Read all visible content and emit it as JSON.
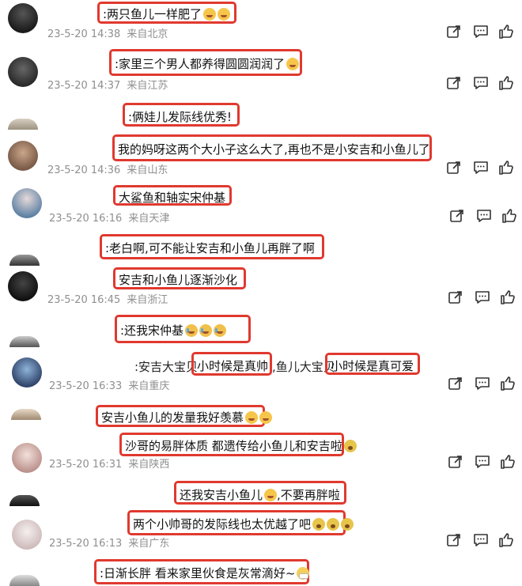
{
  "comments": [
    {
      "text": ":两只鱼儿一样肥了",
      "emojis": [
        "smile",
        "laugh"
      ],
      "time": "23-5-20 14:38",
      "location": "来自北京"
    },
    {
      "text": ":家里三个男人都养得圆圆润润了",
      "emojis": [
        "laugh"
      ],
      "time": "23-5-20 14:37",
      "location": "来自江苏"
    },
    {
      "text": ":俩娃儿发际线优秀!",
      "emojis": [],
      "time": "",
      "location": ""
    },
    {
      "text": "我的妈呀这两个大小子这么大了,再也不是小安吉和小鱼儿了",
      "emojis": [],
      "time": "23-5-20 14:36",
      "location": "来自山东"
    },
    {
      "text": "大鲨鱼和轴实宋仲基",
      "emojis": [],
      "time": "23-5-20 16:16",
      "location": "来自天津"
    },
    {
      "text": ":老白啊,可不能让安吉和小鱼儿再胖了啊",
      "emojis": [],
      "time": "",
      "location": ""
    },
    {
      "text": "安吉和小鱼儿逐渐沙化",
      "emojis": [],
      "time": "23-5-20 16:45",
      "location": "来自浙江"
    },
    {
      "text": ":还我宋仲基",
      "emojis": [
        "cry",
        "cry",
        "cry"
      ],
      "time": "",
      "location": ""
    },
    {
      "prefix": ":安吉大宝贝",
      "text_a": "小时候是真帅",
      "middle": ",鱼儿大宝贝",
      "text_b": "小时候是真可爱",
      "time": "23-5-20 16:33",
      "location": "来自重庆"
    },
    {
      "text": "安吉小鱼儿的发量我好羡慕",
      "emojis": [
        "laugh",
        "laugh"
      ],
      "time": "",
      "location": ""
    },
    {
      "text": "沙哥的易胖体质 都遗传给小鱼儿和安吉啦",
      "emojis": [
        "fear"
      ],
      "time": "23-5-20 16:31",
      "location": "来自陕西"
    },
    {
      "text": "还我安吉小鱼儿",
      "after": ",不要再胖啦",
      "emojis": [
        "laugh"
      ],
      "time": "",
      "location": ""
    },
    {
      "text": "两个小帅哥的发际线也太优越了吧",
      "emojis": [
        "fear",
        "fear",
        "fear"
      ],
      "time": "23-5-20 16:13",
      "location": "来自广东"
    },
    {
      "text": ":日渐长胖 看来家里伙食是灰常滴好~",
      "emojis": [
        "mask"
      ],
      "time": "",
      "location": ""
    }
  ],
  "colors": {
    "highlight": "#e0392f",
    "meta": "#8f8f8f",
    "icon": "#333333"
  },
  "icons": {
    "share": "share-icon",
    "comment": "comment-icon",
    "like": "thumbs-up-icon"
  }
}
